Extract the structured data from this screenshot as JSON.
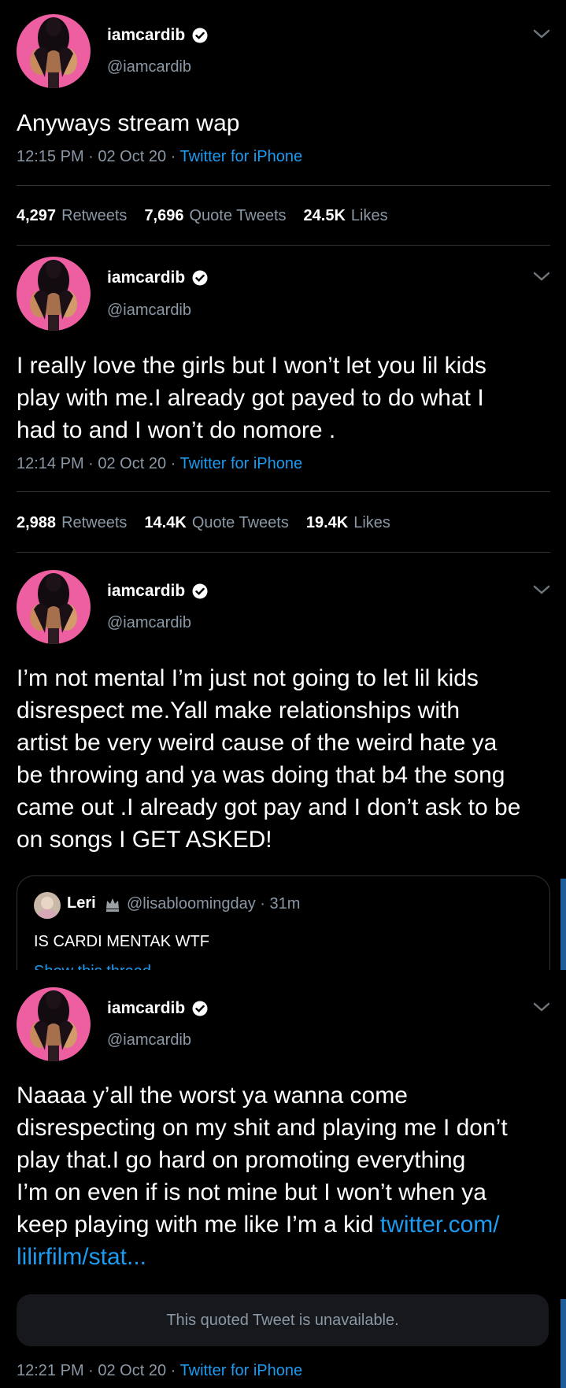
{
  "tweets": [
    {
      "name": "iamcardib",
      "handle": "@iamcardib",
      "text": "Anyways stream wap",
      "time": "12:15 PM · 02 Oct 20 · ",
      "source": "Twitter for iPhone",
      "retweets": "4,297",
      "retweets_label": "Retweets",
      "quotes": "7,696",
      "quotes_label": "Quote Tweets",
      "likes": "24.5K",
      "likes_label": "Likes"
    },
    {
      "name": "iamcardib",
      "handle": "@iamcardib",
      "text_lines": [
        "I really love the girls but I won’t let you lil kids",
        "play with me.I already got payed to do what I",
        "had to and I won’t do nomore ."
      ],
      "time": "12:14 PM · 02 Oct 20 · ",
      "source": "Twitter for iPhone",
      "retweets": "2,988",
      "retweets_label": "Retweets",
      "quotes": "14.4K",
      "quotes_label": "Quote Tweets",
      "likes": "19.4K",
      "likes_label": "Likes"
    },
    {
      "name": "iamcardib",
      "handle": "@iamcardib",
      "text_lines": [
        "I’m not mental I’m just not going to let lil kids",
        "disrespect me.Yall make relationships with",
        "artist be very weird cause of the weird hate ya",
        "be throwing and ya was doing that b4 the song",
        "came out .I already got pay and I don’t ask to be",
        "on songs I GET ASKED!"
      ],
      "quote": {
        "name": "Leri",
        "handle": "@lisabloomingday",
        "age": "· 31m",
        "text": "IS CARDI MENTAK WTF",
        "show_thread": "Show this thread"
      }
    },
    {
      "name": "iamcardib",
      "handle": "@iamcardib",
      "text_lines": [
        "Naaaa y’all the worst ya wanna come",
        "disrespecting on my shit and playing me I don’t",
        "play that.I go hard on promoting everything",
        "I’m on even if is not mine but I won’t when ya"
      ],
      "text_line5": "keep playing with me like I’m a kid ",
      "link_part1": "twitter.com/",
      "link_part2": "lilirfilm/stat...",
      "unavailable": "This quoted Tweet is unavailable.",
      "time": "12:21 PM · 02 Oct 20 · ",
      "source": "Twitter for iPhone"
    }
  ],
  "colors": {
    "accent": "#1d9bf0",
    "muted": "#8b98a5",
    "avatar_bg": "#ee5fa2",
    "background": "#000000"
  },
  "icons": [
    "verified-badge-icon",
    "chevron-down-icon",
    "crown-icon"
  ]
}
